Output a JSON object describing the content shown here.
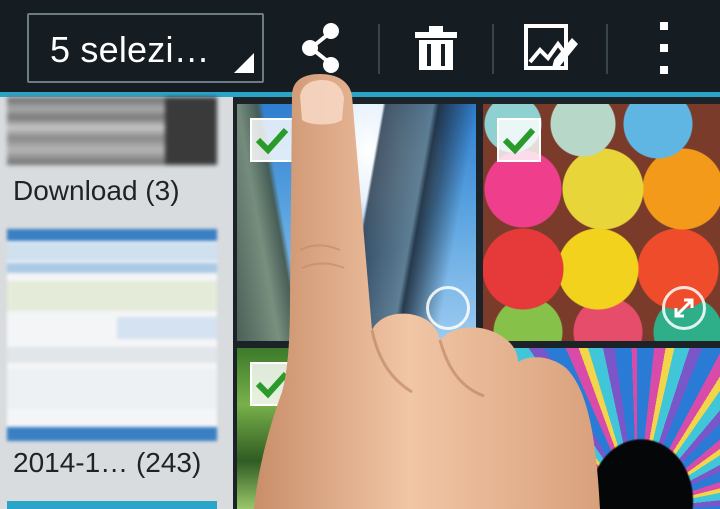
{
  "action_bar": {
    "selection_label": "5 selezi…",
    "buttons": [
      {
        "name": "share-button",
        "icon": "share-icon"
      },
      {
        "name": "delete-button",
        "icon": "trash-icon"
      },
      {
        "name": "edit-button",
        "icon": "image-edit-icon"
      },
      {
        "name": "overflow-menu-button",
        "icon": "more-vertical-icon"
      }
    ],
    "accent_color": "#2aa5c9"
  },
  "albums": [
    {
      "label": "Download (3)"
    },
    {
      "label": "2014-1… (243)"
    }
  ],
  "photos": [
    {
      "subject": "skyscrapers",
      "selected": true
    },
    {
      "subject": "yarn balls",
      "selected": true
    },
    {
      "subject": "forest",
      "selected": true
    },
    {
      "subject": "glass dome",
      "selected": false
    }
  ],
  "colors": {
    "check": "#2a9a2a",
    "bar_background": "#151d22"
  }
}
